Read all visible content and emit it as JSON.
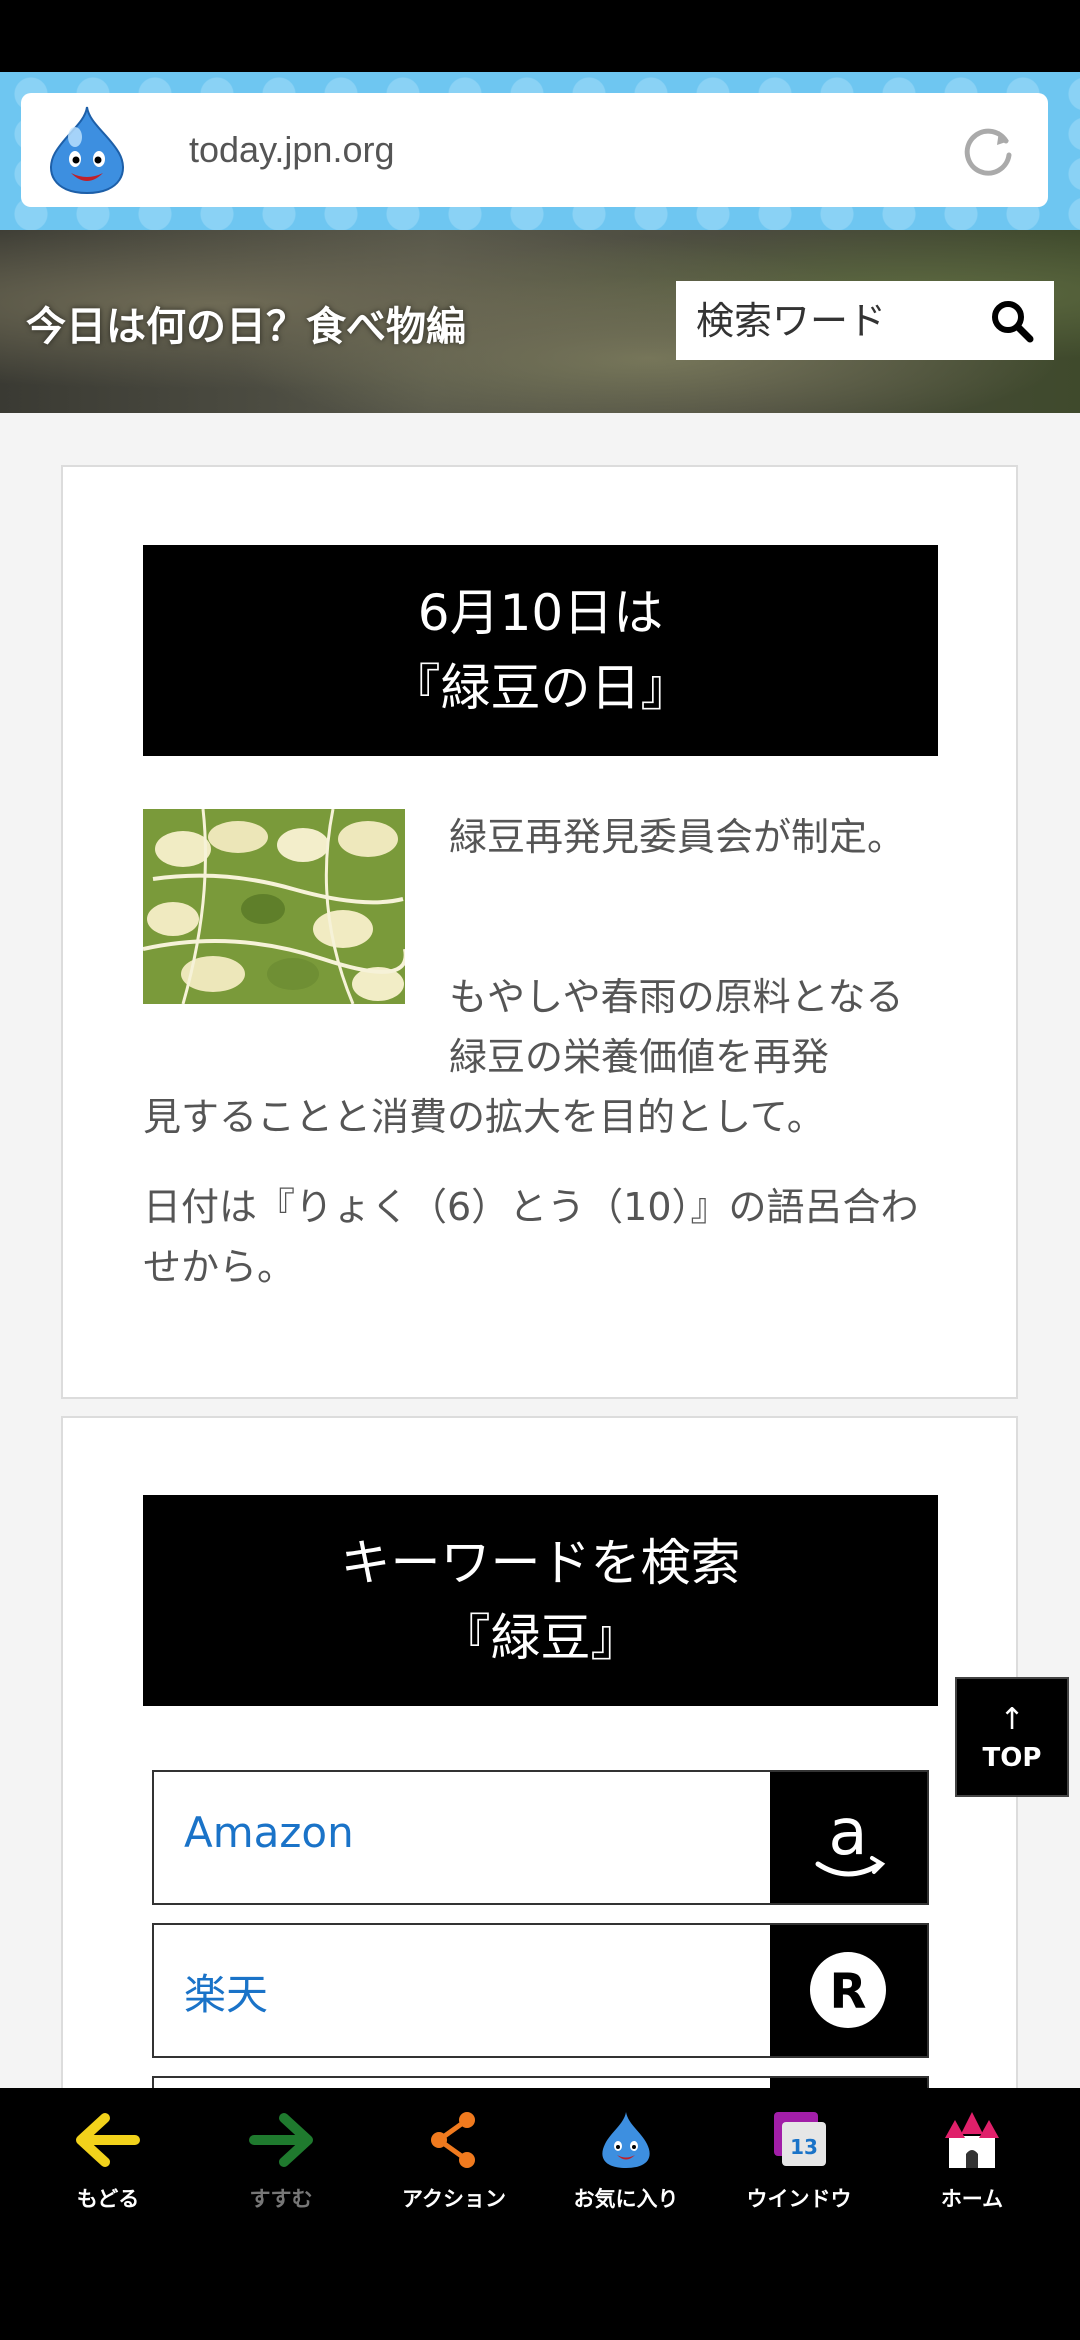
{
  "browser": {
    "url": "today.jpn.org"
  },
  "header": {
    "title": "今日は何の日？食べ物編",
    "search_placeholder": "検索ワード"
  },
  "article": {
    "title_line1": "6月10日は",
    "title_line2": "『緑豆の日』",
    "desc1": "緑豆再発見委員会が制定。",
    "desc2": "もやしや春雨の原料となる緑豆の栄養価値を再発",
    "desc2b": "見することと消費の拡大を目的として。",
    "desc3": "日付は『りょく（6）とう（10）』の語呂合わせから。"
  },
  "keyword": {
    "title_line1": "キーワードを検索",
    "title_line2": "『緑豆』",
    "shops": [
      {
        "label": "Amazon"
      },
      {
        "label": "楽天"
      }
    ]
  },
  "top_button": {
    "arrow": "↑",
    "label": "TOP"
  },
  "bottom_nav": {
    "items": [
      {
        "label": "もどる"
      },
      {
        "label": "すすむ"
      },
      {
        "label": "アクション"
      },
      {
        "label": "お気に入り"
      },
      {
        "label": "ウインドウ",
        "badge": "13"
      },
      {
        "label": "ホーム"
      }
    ]
  },
  "colors": {
    "url_bar_bg": "#6ec6f1",
    "link": "#1a73c8",
    "back_arrow": "#f2d21b",
    "forward_arrow": "#1f7a2e",
    "share": "#f07a1e"
  }
}
